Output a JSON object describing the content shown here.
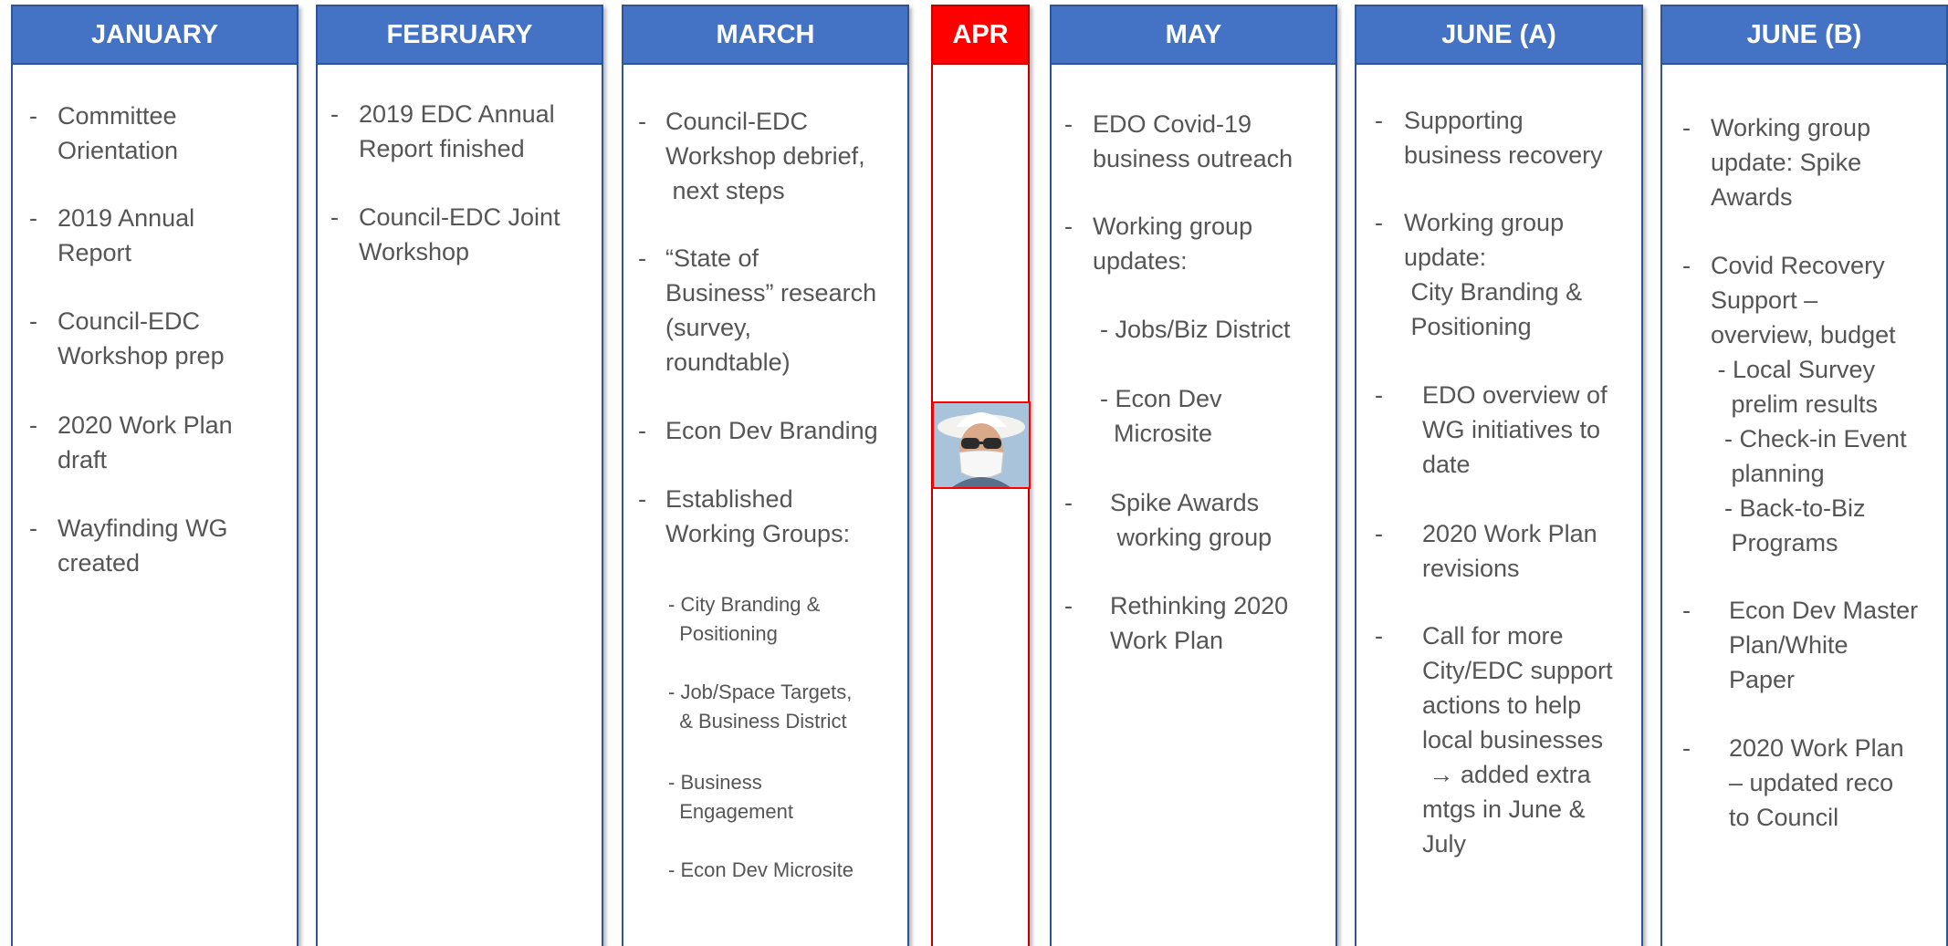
{
  "columns": [
    {
      "title": "JANUARY",
      "items": [
        "Committee\nOrientation",
        "2019 Annual\nReport",
        "Council-EDC\nWorkshop prep",
        "2020 Work Plan\ndraft",
        "Wayfinding WG\ncreated"
      ]
    },
    {
      "title": "FEBRUARY",
      "items": [
        "2019 EDC Annual\nReport finished",
        "Council-EDC Joint\nWorkshop"
      ]
    },
    {
      "title": "MARCH",
      "items": [
        "Council-EDC\nWorkshop debrief,\n next steps",
        "“State of\nBusiness” research\n(survey,\nroundtable)",
        "Econ Dev Branding",
        "Established\nWorking Groups:",
        "- City Branding &\n  Positioning",
        "- Job/Space Targets,\n  & Business District",
        "- Business\n  Engagement",
        "- Econ Dev Microsite"
      ]
    },
    {
      "title": "APR",
      "items": []
    },
    {
      "title": "MAY",
      "items": [
        "EDO Covid-19\nbusiness outreach",
        "Working group\nupdates:",
        "- Jobs/Biz District",
        "- Econ Dev\n  Microsite",
        "Spike Awards\n working group",
        "Rethinking 2020\nWork Plan"
      ]
    },
    {
      "title": "JUNE (A)",
      "items": [
        "Supporting\nbusiness recovery",
        "Working group\nupdate:\n City Branding &\n Positioning",
        "EDO overview of\nWG initiatives to\ndate",
        "2020 Work Plan\nrevisions",
        "Call for more\nCity/EDC support\nactions to help\nlocal businesses\n → added extra\nmtgs in June &\nJuly"
      ]
    },
    {
      "title": "JUNE (B)",
      "items": [
        "Working group\nupdate: Spike\nAwards",
        "Covid Recovery\nSupport –\noverview, budget\n - Local Survey\n   prelim results\n  - Check-in Event\n   planning\n  - Back-to-Biz\n   Programs",
        "Econ Dev Master\nPlan/White\nPaper",
        "2020 Work Plan\n– updated reco\nto Council"
      ]
    }
  ]
}
